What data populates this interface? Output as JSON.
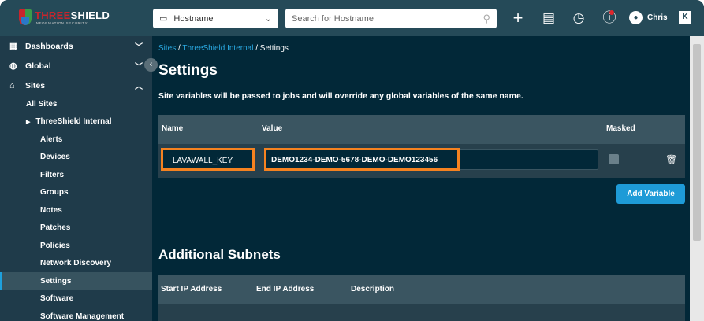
{
  "header": {
    "logo_brand_a": "THREE",
    "logo_brand_b": "SHIELD",
    "logo_sub": "INFORMATION SECURITY",
    "host_select": "Hostname",
    "search_placeholder": "Search for Hostname",
    "user": "Chris",
    "k_label": "K"
  },
  "sidebar": {
    "top": [
      {
        "label": "Dashboards"
      },
      {
        "label": "Global"
      },
      {
        "label": "Sites"
      }
    ],
    "all_sites": "All Sites",
    "site": "ThreeShield Internal",
    "items": [
      "Alerts",
      "Devices",
      "Filters",
      "Groups",
      "Notes",
      "Patches",
      "Policies",
      "Network Discovery",
      "Settings",
      "Software",
      "Software Management"
    ],
    "active": "Settings"
  },
  "breadcrumb": {
    "sites": "Sites",
    "site": "ThreeShield Internal",
    "current": "Settings"
  },
  "page": {
    "title": "Settings",
    "description": "Site variables will be passed to jobs and will override any global variables of the same name."
  },
  "variables": {
    "columns": [
      "Name",
      "Value",
      "Masked"
    ],
    "rows": [
      {
        "name": "LAVAWALL_KEY",
        "value": "DEMO1234-DEMO-5678-DEMO-DEMO123456",
        "masked": false
      }
    ],
    "add_label": "Add Variable"
  },
  "subnets": {
    "title": "Additional Subnets",
    "columns": [
      "Start IP Address",
      "End IP Address",
      "Description"
    ]
  },
  "colors": {
    "accent": "#1e9bd7",
    "highlight": "#f58220",
    "background": "#022838"
  }
}
